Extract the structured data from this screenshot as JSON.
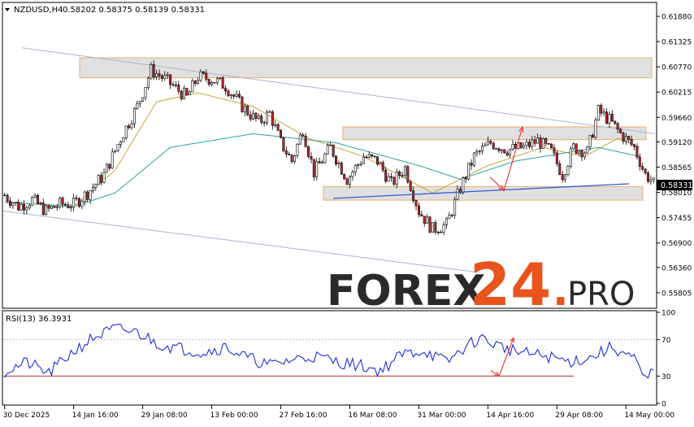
{
  "header": {
    "symbol_label": "NZDUSD,H4",
    "ohlc": "0.58202 0.58375 0.58139 0.58331"
  },
  "watermark": {
    "brand": "FOREX",
    "number": "24",
    "dot": ".",
    "suffix": "PRO",
    "colors": {
      "dark": "#2a2a2a",
      "accent": "#e8541e"
    }
  },
  "colors": {
    "up_body": "#ffffff",
    "candle": "#000000",
    "down_body": "#c1272d",
    "ma_fast": "#c8a23a",
    "ma_slow": "#2aa39a",
    "zone_fill": "#e0e0e0",
    "zone_border": "#e8b070",
    "channel": "#a8b8cc",
    "support": "#2e5fd0",
    "forecast_arrow": "#e84040",
    "rsi_line": "#1f2fd6",
    "rsi_level": "#b03030",
    "price_tag": "#000000"
  },
  "chart_data": [
    {
      "type": "candlestick",
      "title": "NZDUSD,H4",
      "ylim": [
        0.555,
        0.6215
      ],
      "y_ticks": [
        "0.61880",
        "0.61325",
        "0.60770",
        "0.60215",
        "0.59660",
        "0.59120",
        "0.58565",
        "0.58010",
        "0.57455",
        "0.56900",
        "0.56360",
        "0.55805"
      ],
      "current_price_label": "0.58331",
      "x_ticks": [
        "30 Dec 2025",
        "14 Jan 16:00",
        "29 Jan 08:00",
        "13 Feb 00:00",
        "27 Feb 16:00",
        "16 Mar 08:00",
        "31 Mar 00:00",
        "14 Apr 16:00",
        "29 Apr 08:00",
        "14 May 00:00"
      ],
      "path_anchors": [
        [
          0,
          0.5795
        ],
        [
          5,
          0.577
        ],
        [
          10,
          0.5785
        ],
        [
          15,
          0.576
        ],
        [
          20,
          0.5775
        ],
        [
          25,
          0.5775
        ],
        [
          30,
          0.58
        ],
        [
          36,
          0.584
        ],
        [
          42,
          0.592
        ],
        [
          48,
          0.599
        ],
        [
          53,
          0.607
        ],
        [
          58,
          0.605
        ],
        [
          62,
          0.603
        ],
        [
          66,
          0.601
        ],
        [
          70,
          0.6055
        ],
        [
          75,
          0.605
        ],
        [
          80,
          0.6035
        ],
        [
          86,
          0.599
        ],
        [
          92,
          0.5955
        ],
        [
          96,
          0.5975
        ],
        [
          100,
          0.591
        ],
        [
          104,
          0.587
        ],
        [
          108,
          0.594
        ],
        [
          112,
          0.5845
        ],
        [
          118,
          0.59
        ],
        [
          124,
          0.583
        ],
        [
          130,
          0.588
        ],
        [
          135,
          0.587
        ],
        [
          140,
          0.582
        ],
        [
          145,
          0.5855
        ],
        [
          150,
          0.576
        ],
        [
          155,
          0.572
        ],
        [
          160,
          0.573
        ],
        [
          165,
          0.581
        ],
        [
          170,
          0.588
        ],
        [
          176,
          0.591
        ],
        [
          182,
          0.5895
        ],
        [
          188,
          0.59
        ],
        [
          193,
          0.5915
        ],
        [
          198,
          0.589
        ],
        [
          202,
          0.584
        ],
        [
          206,
          0.59
        ],
        [
          211,
          0.589
        ],
        [
          215,
          0.598
        ],
        [
          219,
          0.596
        ],
        [
          223,
          0.593
        ],
        [
          228,
          0.59
        ],
        [
          232,
          0.584
        ],
        [
          235,
          0.5825
        ]
      ],
      "ma_fast": [
        [
          0,
          0.578
        ],
        [
          25,
          0.577
        ],
        [
          40,
          0.585
        ],
        [
          55,
          0.6
        ],
        [
          70,
          0.602
        ],
        [
          90,
          0.599
        ],
        [
          110,
          0.592
        ],
        [
          130,
          0.588
        ],
        [
          155,
          0.58
        ],
        [
          175,
          0.586
        ],
        [
          195,
          0.59
        ],
        [
          210,
          0.588
        ],
        [
          222,
          0.592
        ],
        [
          230,
          0.59
        ]
      ],
      "ma_slow": [
        [
          0,
          0.578
        ],
        [
          25,
          0.577
        ],
        [
          40,
          0.58
        ],
        [
          60,
          0.59
        ],
        [
          90,
          0.593
        ],
        [
          120,
          0.591
        ],
        [
          150,
          0.586
        ],
        [
          165,
          0.583
        ],
        [
          185,
          0.587
        ],
        [
          215,
          0.59
        ],
        [
          230,
          0.588
        ]
      ],
      "zones": [
        {
          "y_top": 0.6097,
          "y_bottom": 0.6053
        },
        {
          "y_top": 0.5945,
          "y_bottom": 0.5917
        },
        {
          "y_top": 0.5814,
          "y_bottom": 0.5784
        }
      ],
      "channel_upper": [
        [
          0.6119
        ],
        [
          0.593
        ]
      ],
      "channel_lower": [
        [
          0.576
        ],
        [
          0.5625
        ]
      ],
      "support_line": [
        [
          0.5788
        ],
        [
          0.582
        ]
      ],
      "forecast": {
        "down_to": 0.5805,
        "up_to": 0.5945
      }
    },
    {
      "type": "line",
      "title": "RSI(13) 36.3931",
      "ylim": [
        0,
        100
      ],
      "levels": [
        30,
        70
      ],
      "y_ticks": [
        "100",
        "70",
        "30",
        "0"
      ],
      "path_anchors": [
        [
          0,
          35
        ],
        [
          8,
          45
        ],
        [
          16,
          33
        ],
        [
          24,
          55
        ],
        [
          32,
          72
        ],
        [
          40,
          82
        ],
        [
          48,
          78
        ],
        [
          56,
          65
        ],
        [
          64,
          60
        ],
        [
          72,
          56
        ],
        [
          80,
          62
        ],
        [
          88,
          50
        ],
        [
          96,
          42
        ],
        [
          104,
          48
        ],
        [
          112,
          52
        ],
        [
          120,
          46
        ],
        [
          128,
          42
        ],
        [
          136,
          36
        ],
        [
          144,
          54
        ],
        [
          152,
          58
        ],
        [
          160,
          45
        ],
        [
          166,
          60
        ],
        [
          172,
          72
        ],
        [
          180,
          62
        ],
        [
          188,
          55
        ],
        [
          196,
          52
        ],
        [
          204,
          46
        ],
        [
          212,
          50
        ],
        [
          220,
          62
        ],
        [
          228,
          48
        ],
        [
          232,
          25
        ],
        [
          235,
          36
        ]
      ],
      "forecast_arrows": [
        {
          "to": 72
        },
        {
          "to": 30
        }
      ]
    }
  ]
}
